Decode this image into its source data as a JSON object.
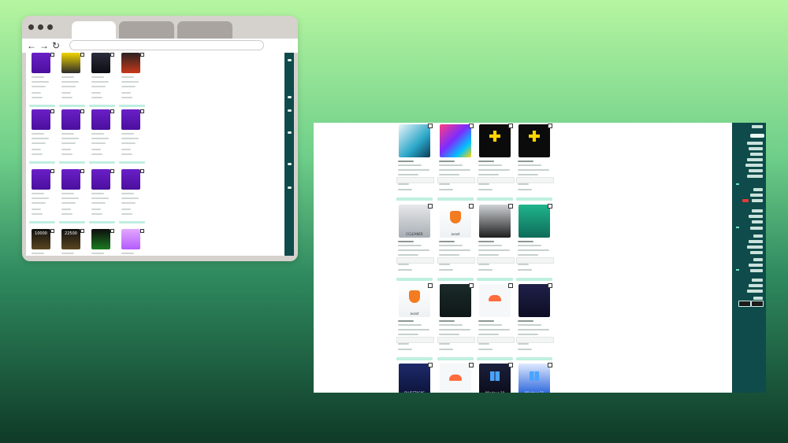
{
  "colors": {
    "sidebar": "#0e4b4a",
    "buy_button": "#bff0df",
    "browser_chrome": "#d5d1cd",
    "tab_inactive": "#a9a4a0"
  },
  "browser": {
    "icons": [
      "back-arrow-icon",
      "forward-arrow-icon",
      "reload-icon"
    ],
    "back": "←",
    "forward": "→",
    "reload": "↻"
  },
  "main_cards": [
    {
      "name": "card-security-1",
      "style": "blue-cyan"
    },
    {
      "name": "card-game-pass",
      "style": "colorful"
    },
    {
      "name": "card-ps-plus-1",
      "style": "black-yellow"
    },
    {
      "name": "card-ps-plus-2",
      "style": "black-yellow"
    },
    {
      "name": "card-ccleaner",
      "style": "gray-box",
      "label": "CCLEANER"
    },
    {
      "name": "card-avast-1",
      "style": "white-orange",
      "label": "avast"
    },
    {
      "name": "card-software-box",
      "style": "dark-box"
    },
    {
      "name": "card-easeus",
      "style": "teal"
    },
    {
      "name": "card-avast-2",
      "style": "white-orange",
      "label": "avast"
    },
    {
      "name": "card-vpn",
      "style": "dark-green"
    },
    {
      "name": "card-cloud-1",
      "style": "white-cloud"
    },
    {
      "name": "card-utility",
      "style": "navy"
    },
    {
      "name": "card-bluestacks",
      "style": "navy-dots",
      "label": "BLUESTACKS"
    },
    {
      "name": "card-cloud-2",
      "style": "white-cloud"
    },
    {
      "name": "card-windows-10",
      "style": "dark-windows",
      "label": "Windows 10"
    },
    {
      "name": "card-windows-11",
      "style": "blue-windows",
      "label": "Windows 11"
    }
  ],
  "mini_cards": [
    {
      "style": "purple"
    },
    {
      "style": "yellow"
    },
    {
      "style": "dark"
    },
    {
      "style": "dark-red"
    },
    {
      "style": "purple"
    },
    {
      "style": "purple"
    },
    {
      "style": "purple"
    },
    {
      "style": "purple"
    },
    {
      "style": "purple"
    },
    {
      "style": "purple"
    },
    {
      "style": "purple"
    },
    {
      "style": "purple"
    },
    {
      "style": "dark-gold",
      "label": "10000"
    },
    {
      "style": "dark-gold",
      "label": "22500"
    },
    {
      "style": "xbox"
    },
    {
      "style": "pink"
    }
  ]
}
